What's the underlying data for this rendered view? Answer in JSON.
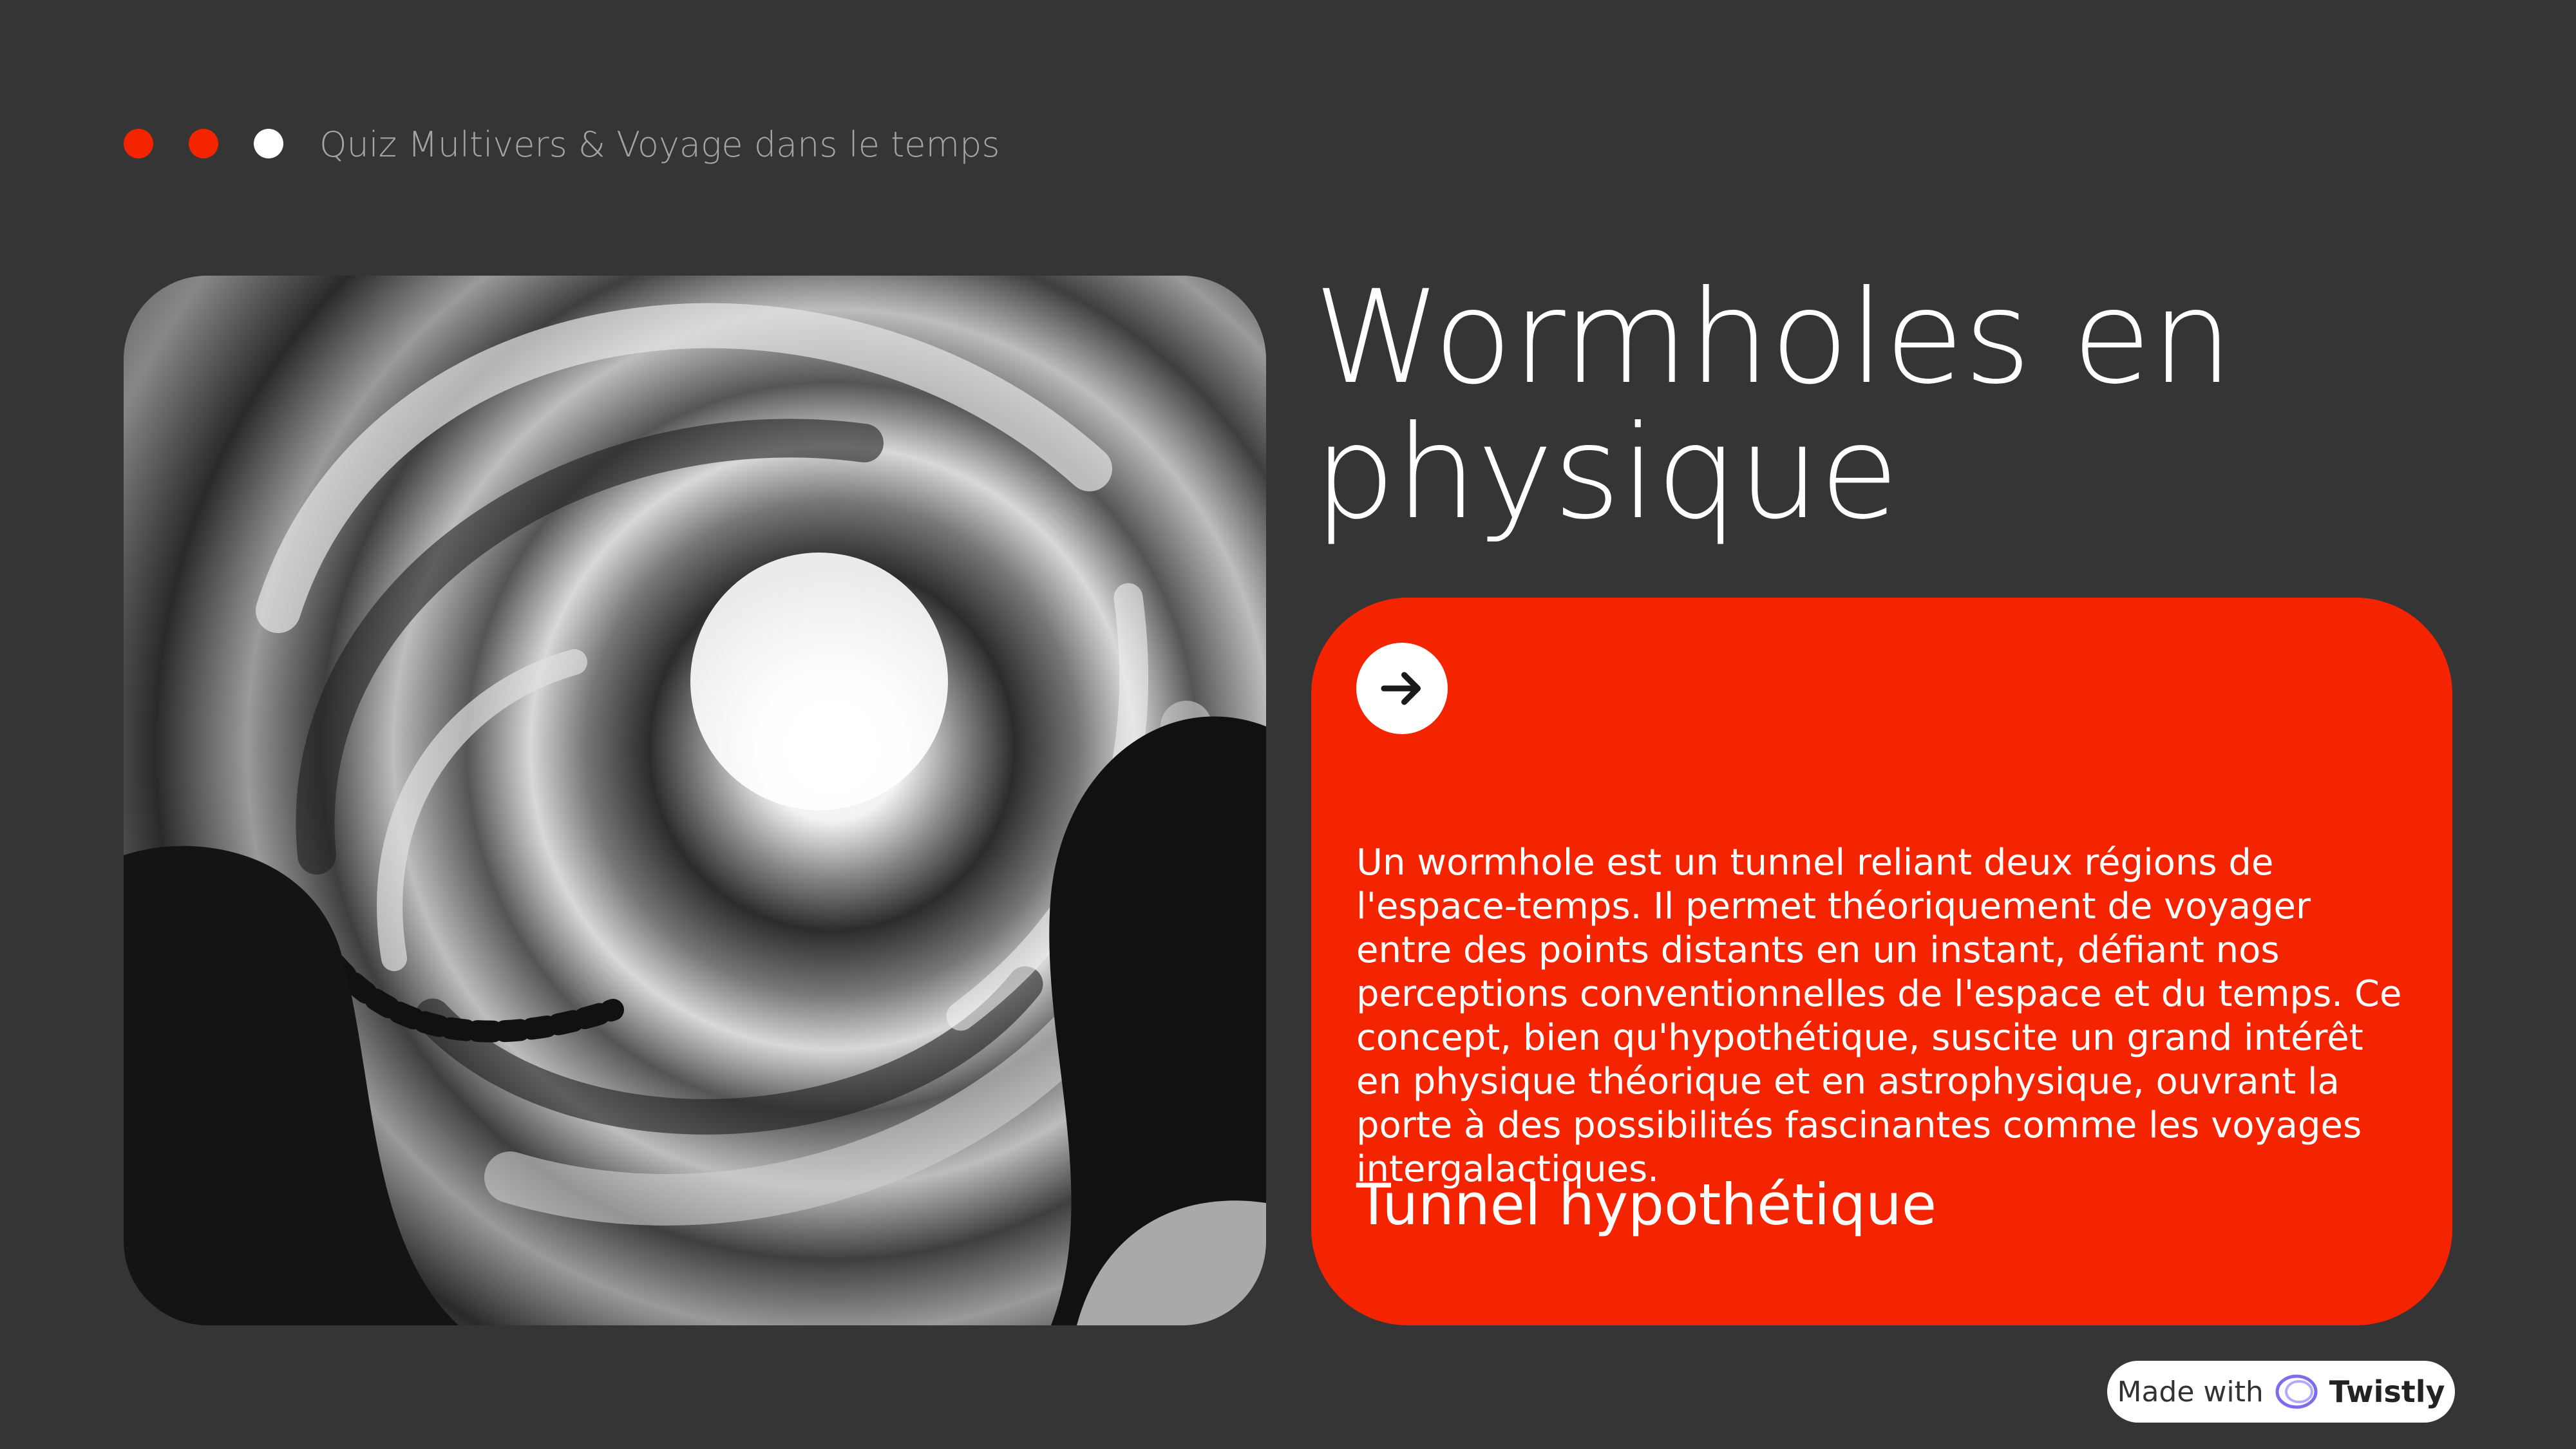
{
  "header": {
    "title": "Quiz Multivers & Voyage dans le temps",
    "dot_colors": [
      "#f52400",
      "#f52400",
      "#ffffff"
    ]
  },
  "hero_image": {
    "icon": "wormhole-illustration",
    "alt": "Deux personnes observant un tunnel tourbillonnant en noir et blanc"
  },
  "main": {
    "title": "Wormholes en physique"
  },
  "card": {
    "icon": "arrow-right-icon",
    "body": "Un wormhole est un tunnel reliant deux régions de l'espace-temps. Il permet théoriquement de voyager entre des points distants en un instant, défiant nos perceptions conventionnelles de l'espace et du temps. Ce concept, bien qu'hypothétique, suscite un grand intérêt en physique théorique et en astrophysique, ouvrant la porte à des possibilités fascinantes comme les voyages intergalactiques.",
    "subtitle": "Tunnel hypothétique"
  },
  "badge": {
    "prefix": "Made with",
    "brand": "Twistly",
    "icon": "twistly-logo-icon"
  },
  "colors": {
    "background": "#353535",
    "accent": "#f52400",
    "text": "#ffffff",
    "muted": "#a4a4a4"
  }
}
